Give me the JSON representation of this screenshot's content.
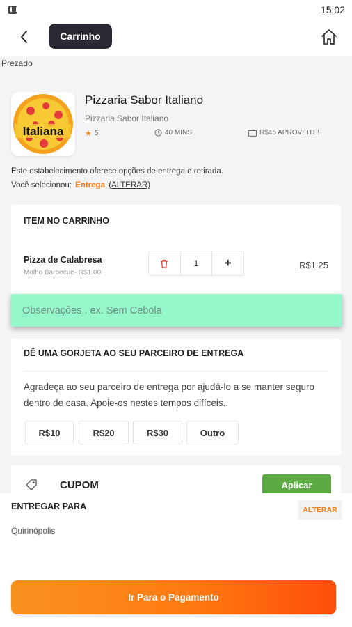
{
  "status_bar": {
    "time": "15:02",
    "app_icon": "app-notification-icon"
  },
  "header": {
    "title": "Carrinho",
    "back_icon": "back-arrow-icon",
    "home_icon": "home-icon"
  },
  "greeting": "Prezado",
  "store": {
    "name": "Pizzaria Sabor Italiano",
    "subtitle": "Pizzaria Sabor Italiano",
    "logo_text": "Italiana",
    "rating": "5",
    "delivery_time": "40 MINS",
    "minimum": "R$45 APROVEITE!",
    "delivery_info": "Este estabelecimento oferece opções de entrega e retirada.",
    "selected_prefix": "Você selecionou:",
    "selected_mode": "Entrega",
    "change_link": "(ALTERAR)"
  },
  "cart": {
    "title": "ITEM NO CARRINHO",
    "items": [
      {
        "name": "Pizza de Calabresa",
        "description": "Molho Barbecue- R$1.00",
        "quantity": "1",
        "plus_label": "+",
        "price": "R$1.25"
      }
    ]
  },
  "notes": {
    "placeholder": "Observações.. ex. Sem Cebola"
  },
  "tip": {
    "title": "DÊ UMA GORJETA AO SEU PARCEIRO DE ENTREGA",
    "text": "Agradeça ao seu parceiro de entrega por ajudá-lo a se manter seguro dentro de casa. Apoie-os nestes tempos difíceis..",
    "options": [
      "R$10",
      "R$20",
      "R$30",
      "Outro"
    ]
  },
  "coupon": {
    "label": "CUPOM",
    "apply_label": "Aplicar"
  },
  "delivery": {
    "title": "ENTREGAR PARA",
    "change_label": "ALTERAR",
    "address": "Quirinópolis"
  },
  "pay_button": "Ir Para o Pagamento",
  "colors": {
    "accent": "#f27d16",
    "header_pill": "#2b2833",
    "notes_bg": "#96f7cb",
    "apply_green": "#5bab42"
  }
}
